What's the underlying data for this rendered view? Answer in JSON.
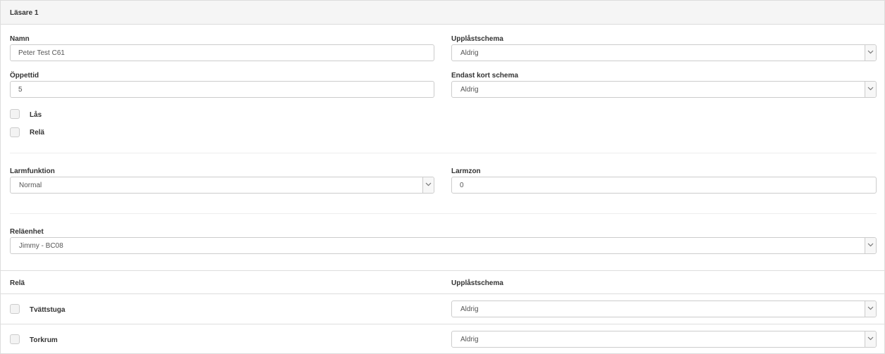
{
  "panel": {
    "title": "Läsare 1"
  },
  "form": {
    "name": {
      "label": "Namn",
      "value": "Peter Test C61"
    },
    "unlock_schedule": {
      "label": "Upplåstschema",
      "value": "Aldrig"
    },
    "open_time": {
      "label": "Öppettid",
      "value": "5"
    },
    "card_only_schedule": {
      "label": "Endast kort schema",
      "value": "Aldrig"
    },
    "lock": {
      "label": "Lås",
      "checked": false
    },
    "relay": {
      "label": "Relä",
      "checked": false
    },
    "alarm_function": {
      "label": "Larmfunktion",
      "value": "Normal"
    },
    "alarm_zone": {
      "label": "Larmzon",
      "value": "0"
    },
    "relay_unit": {
      "label": "Reläenhet",
      "value": "Jimmy - BC08"
    }
  },
  "relay_table": {
    "headers": {
      "relay": "Relä",
      "schedule": "Upplåstschema"
    },
    "rows": [
      {
        "name": "Tvättstuga",
        "checked": false,
        "schedule": "Aldrig"
      },
      {
        "name": "Torkrum",
        "checked": false,
        "schedule": "Aldrig"
      }
    ]
  },
  "icons": {
    "select_arrow": "chevron-down-icon"
  },
  "colors": {
    "border": "#cccccc",
    "heading_bg": "#f5f5f5",
    "text": "#333333"
  }
}
